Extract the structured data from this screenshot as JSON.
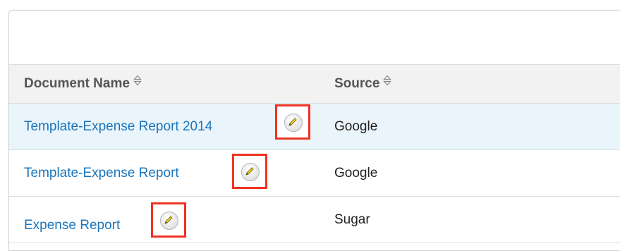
{
  "table": {
    "columns": [
      {
        "label": "Document Name",
        "sort_icon": "sort-both-icon"
      },
      {
        "label": "Source",
        "sort_icon": "sort-both-icon"
      }
    ],
    "rows": [
      {
        "name": "Template-Expense Report 2014",
        "source": "Google",
        "selected": true
      },
      {
        "name": "Template-Expense Report",
        "source": "Google",
        "selected": false
      },
      {
        "name": "Expense Report",
        "source": "Sugar",
        "selected": false
      }
    ]
  },
  "row_action": {
    "icon": "pencil-icon"
  },
  "colors": {
    "link": "#1b75bb",
    "highlight_border": "#ee3322",
    "header_bg": "#f2f2f2",
    "selected_row_bg": "#eaf4fb"
  }
}
